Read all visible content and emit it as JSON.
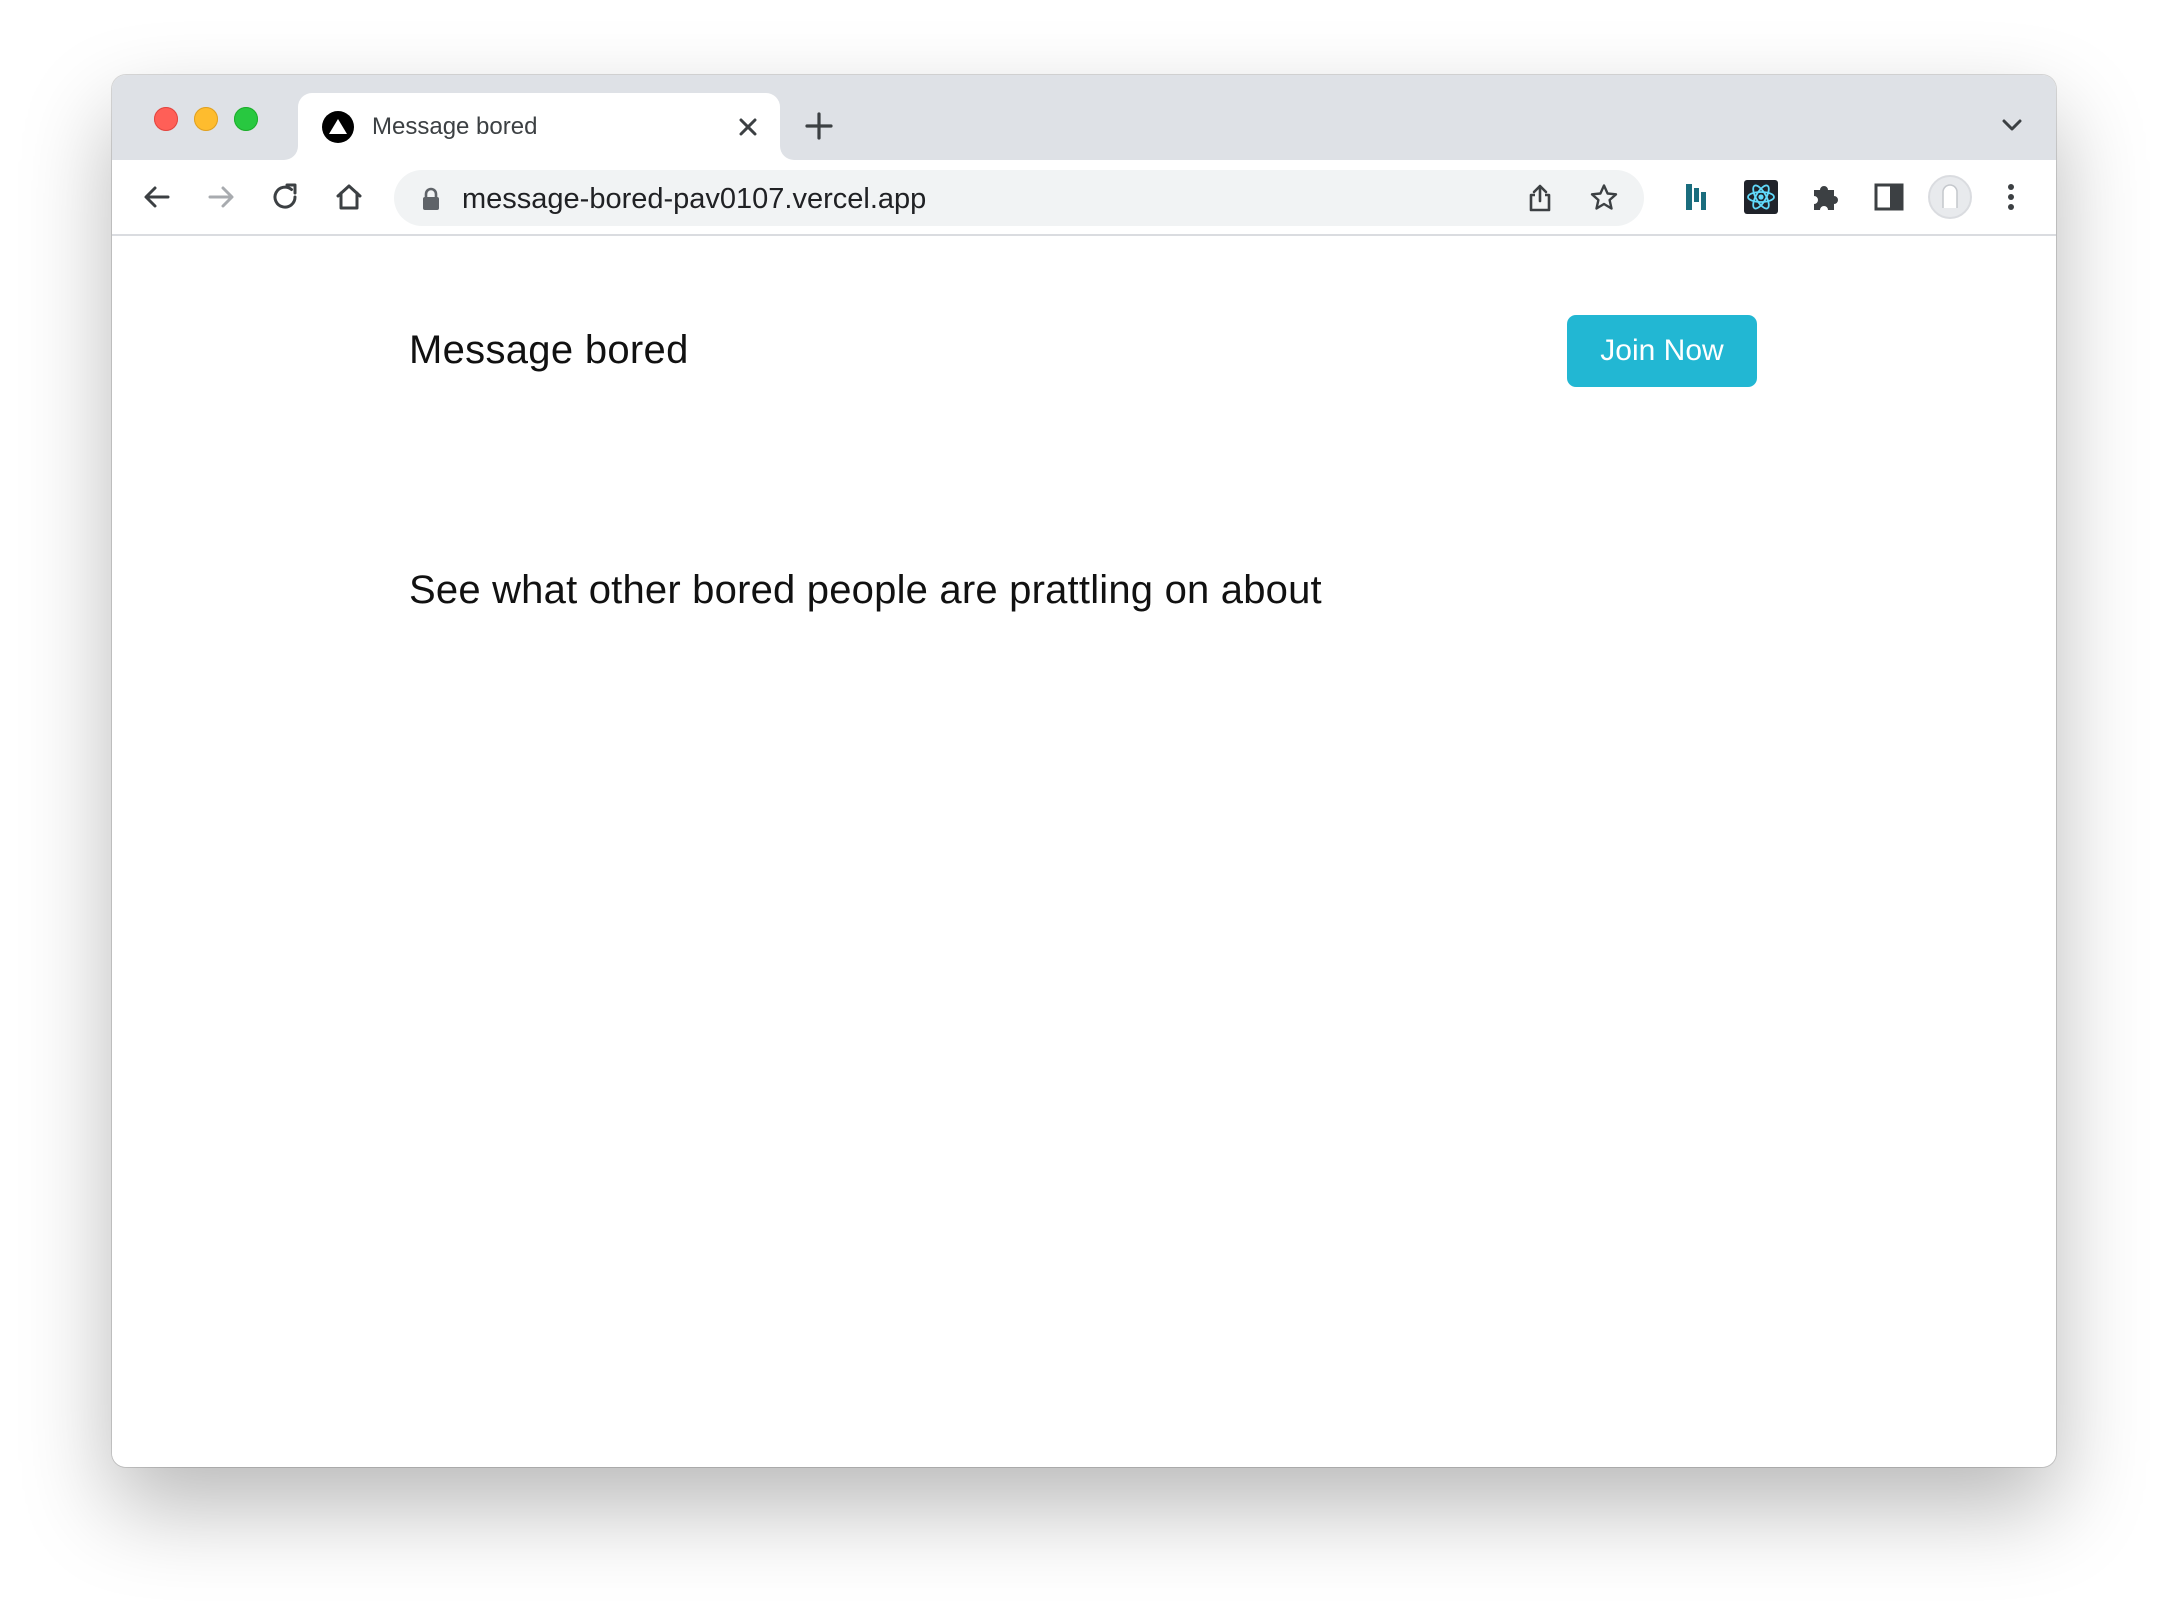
{
  "browser": {
    "tab": {
      "title": "Message bored",
      "favicon": "triangle-logo-icon"
    },
    "address_bar": {
      "url": "message-bored-pav0107.vercel.app"
    },
    "toolbar_icons": [
      "back-arrow-icon",
      "forward-arrow-icon",
      "reload-icon",
      "home-icon",
      "lock-icon",
      "share-icon",
      "bookmark-star-icon",
      "extension-bars-icon",
      "react-devtools-icon",
      "puzzle-extensions-icon",
      "side-panel-icon",
      "profile-avatar-icon",
      "more-menu-icon"
    ]
  },
  "page": {
    "site_title": "Message bored",
    "join_button_label": "Join Now",
    "tagline": "See what other bored people are prattling on about"
  },
  "colors": {
    "accent": "#22b7d3",
    "tabstrip": "#dee1e6",
    "omnibox": "#f1f3f4"
  }
}
